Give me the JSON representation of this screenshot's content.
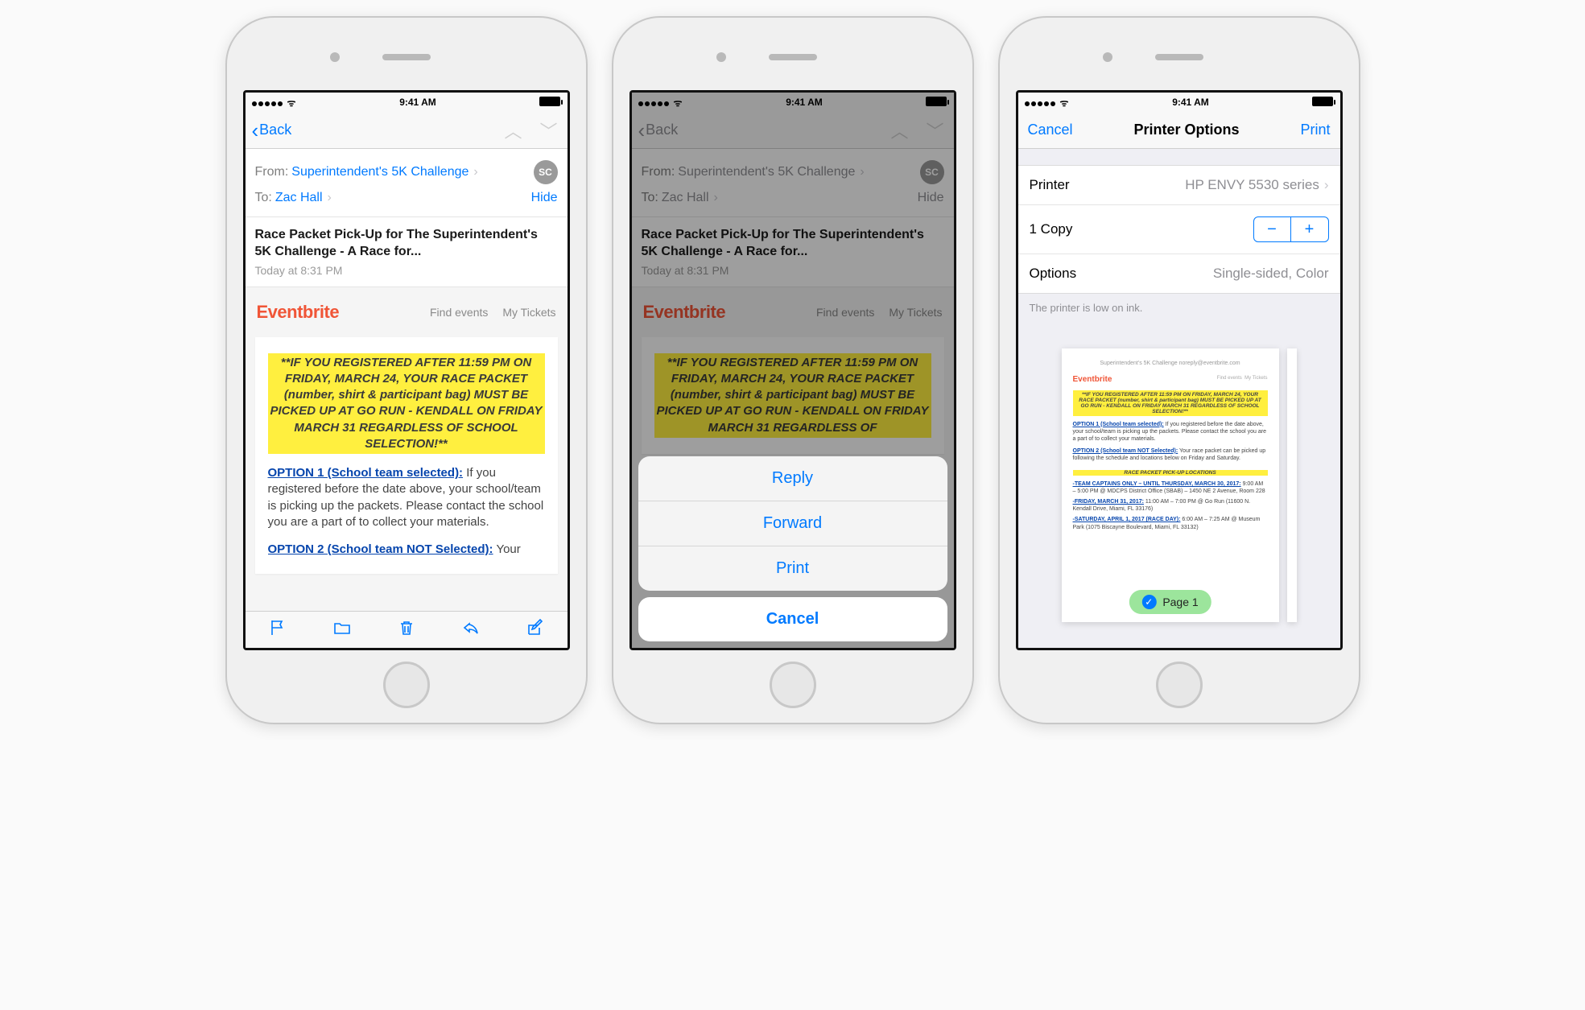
{
  "status": {
    "time": "9:41 AM"
  },
  "mail": {
    "back": "Back",
    "from_label": "From:",
    "from_value": "Superintendent's 5K Challenge",
    "to_label": "To:",
    "to_value": "Zac Hall",
    "hide": "Hide",
    "avatar": "SC",
    "subject": "Race Packet Pick-Up for The Superintendent's 5K Challenge - A Race for...",
    "timestamp": "Today at 8:31 PM"
  },
  "eventbrite": {
    "brand": "Eventbrite",
    "find": "Find events",
    "tickets": "My Tickets"
  },
  "body": {
    "highlight": "**IF YOU REGISTERED AFTER 11:59 PM ON FRIDAY, MARCH 24, YOUR RACE PACKET (number, shirt & participant bag) MUST BE PICKED UP AT GO RUN - KENDALL ON FRIDAY MARCH 31 REGARDLESS OF SCHOOL SELECTION!**",
    "highlight_trunc": "**IF YOU REGISTERED AFTER 11:59 PM ON FRIDAY, MARCH 24, YOUR RACE PACKET (number, shirt & participant bag) MUST BE PICKED UP AT GO RUN - KENDALL ON FRIDAY MARCH 31 REGARDLESS OF",
    "opt1_label": "OPTION 1 (School team selected):",
    "opt1_text": " If you registered before the date above, your school/team is picking up the packets. Please contact the school you are a part of to collect your materials.",
    "opt2_label": "OPTION 2 (School team NOT Selected):",
    "opt2_text": " Your"
  },
  "sheet": {
    "reply": "Reply",
    "forward": "Forward",
    "print": "Print",
    "cancel": "Cancel"
  },
  "printer": {
    "cancel": "Cancel",
    "title": "Printer Options",
    "print": "Print",
    "printer_label": "Printer",
    "printer_value": "HP ENVY 5530 series",
    "copies": "1 Copy",
    "options_label": "Options",
    "options_value": "Single-sided, Color",
    "hint": "The printer is low on ink.",
    "page_label": "Page 1"
  },
  "preview": {
    "header": "Superintendent's 5K Challenge noreply@eventbrite.com",
    "hl": "**IF YOU REGISTERED AFTER 11:59 PM ON FRIDAY, MARCH 24, YOUR RACE PACKET (number, shirt & participant bag) MUST BE PICKED UP AT GO RUN - KENDALL ON FRIDAY MARCH 31 REGARDLESS OF SCHOOL SELECTION!**",
    "opt1_label": "OPTION 1 (School team selected):",
    "opt1_text": " If you registered before the date above, your school/team is picking up the packets. Please contact the school you are a part of to collect your materials.",
    "opt2_label": "OPTION 2 (School team NOT Selected):",
    "opt2_text": " Your race packet can be picked up following the schedule and locations below on Friday and Saturday.",
    "loc_header": "RACE PACKET PICK-UP LOCATIONS",
    "li1a": "-TEAM CAPTAINS ONLY – UNTIL THURSDAY, MARCH 30, 2017:",
    "li1b": " 9:00 AM – 5:00 PM @ MDCPS District Office (SBAB) – 1450 NE 2 Avenue, Room 228",
    "li2a": "-FRIDAY, MARCH 31, 2017:",
    "li2b": " 11:00 AM – 7:00 PM @ Go Run (11600 N. Kendall Drive, Miami, FL 33176)",
    "li3a": "-SATURDAY, APRIL 1, 2017 (RACE DAY):",
    "li3b": " 6:00 AM – 7:25 AM @ Museum Park (1075 Biscayne Boulevard, Miami, FL 33132)"
  }
}
